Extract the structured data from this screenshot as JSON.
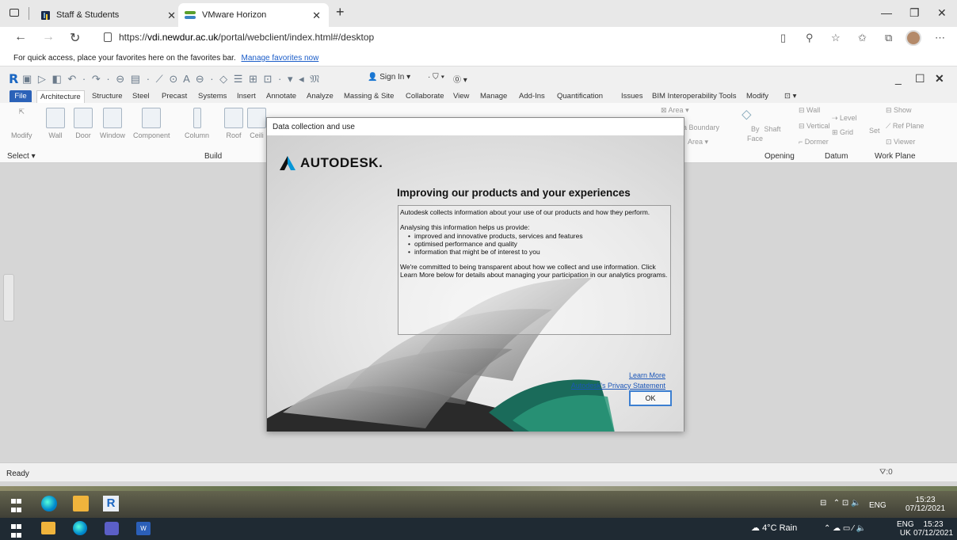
{
  "browser": {
    "tabs": [
      {
        "label": "Staff & Students"
      },
      {
        "label": "VMware Horizon"
      }
    ],
    "url_prefix": "https://",
    "url_host": "vdi.newdur.ac.uk",
    "url_path": "/portal/webclient/index.html#/desktop",
    "favbar_text": "For quick access, place your favorites here on the favorites bar.",
    "favbar_link": "Manage favorites now"
  },
  "revit": {
    "signin": "Sign In",
    "ribbon_tabs": [
      "File",
      "Architecture",
      "Structure",
      "Steel",
      "Precast",
      "Systems",
      "Insert",
      "Annotate",
      "Analyze",
      "Massing & Site",
      "Collaborate",
      "View",
      "Manage",
      "Add-Ins",
      "Quantification",
      "Issues",
      "BIM Interoperability Tools",
      "Modify"
    ],
    "buttons": [
      "Modify",
      "Wall",
      "Door",
      "Window",
      "Component",
      "Column",
      "Roof",
      "Ceili"
    ],
    "panels": {
      "select": "Select",
      "build": "Build",
      "opening": "Opening",
      "datum": "Datum",
      "workplane": "Work Plane"
    },
    "right_tools": {
      "area": "Area",
      "boundary": "a Boundary",
      "area2": "Area",
      "by_face": "By",
      "face": "Face",
      "shaft": "Shaft",
      "wall": "Wall",
      "vertical": "Vertical",
      "dormer": "Dormer",
      "level": "Level",
      "grid": "Grid",
      "set": "Set",
      "show": "Show",
      "ref_plane": "Ref Plane",
      "viewer": "Viewer"
    },
    "status": "Ready",
    "filter_count": ":0"
  },
  "dialog": {
    "title": "Data collection and use",
    "logo": "AUTODESK.",
    "heading": "Improving our products and your experiences",
    "p1": "Autodesk collects information about your use of our products and how they perform.",
    "p2": "Analysing this information helps us provide:",
    "bullets": [
      "improved and innovative products, services and features",
      "optimised performance and quality",
      "information that might be of interest to you"
    ],
    "p3": "We're committed to being transparent about how we collect and use information. Click Learn More below for details about managing your participation in our analytics programs.",
    "learn_more": "Learn More",
    "privacy": "Autodesk's Privacy Statement",
    "ok": "OK"
  },
  "vm_taskbar": {
    "lang": "ENG",
    "time": "15:23",
    "date": "07/12/2021"
  },
  "host_taskbar": {
    "weather": "4°C Rain",
    "lang": "ENG",
    "region": "UK",
    "time": "15:23",
    "date": "07/12/2021"
  }
}
